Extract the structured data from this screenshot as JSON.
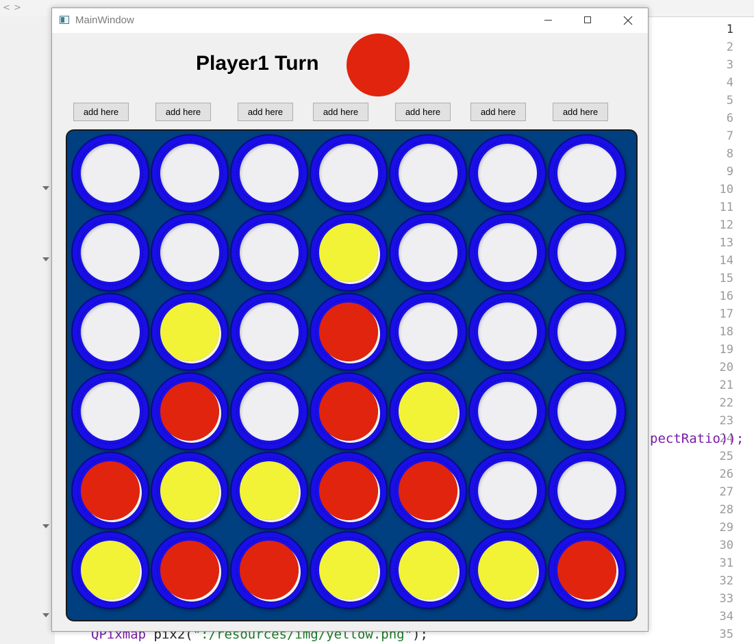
{
  "ide": {
    "nav_back": "<",
    "nav_forward": ">",
    "line_numbers": [
      "1",
      "2",
      "3",
      "4",
      "5",
      "6",
      "7",
      "8",
      "9",
      "10",
      "11",
      "12",
      "13",
      "14",
      "15",
      "16",
      "17",
      "18",
      "19",
      "20",
      "21",
      "22",
      "23",
      "24",
      "25",
      "26",
      "27",
      "28",
      "29",
      "30",
      "31",
      "32",
      "33",
      "34",
      "35"
    ],
    "code_fragment_line24": "pectRatio));",
    "code_line35_type": "QPixmap",
    "code_line35_rest": " pix2(",
    "code_line35_string": "\":/resources/img/yellow.png\"",
    "code_line35_end": ");"
  },
  "window": {
    "title": "MainWindow",
    "minimize_icon": "minimize-icon",
    "maximize_icon": "maximize-icon",
    "close_icon": "close-icon"
  },
  "game": {
    "turn_label": "Player1 Turn",
    "turn_color": "red",
    "add_button_label": "add here",
    "columns": 7,
    "rows": 6,
    "board": [
      [
        "empty",
        "empty",
        "empty",
        "empty",
        "empty",
        "empty",
        "empty"
      ],
      [
        "empty",
        "empty",
        "empty",
        "yellow",
        "empty",
        "empty",
        "empty"
      ],
      [
        "empty",
        "yellow",
        "empty",
        "red",
        "empty",
        "empty",
        "empty"
      ],
      [
        "empty",
        "red",
        "empty",
        "red",
        "yellow",
        "empty",
        "empty"
      ],
      [
        "red",
        "yellow",
        "yellow",
        "red",
        "red",
        "empty",
        "empty"
      ],
      [
        "yellow",
        "red",
        "red",
        "yellow",
        "yellow",
        "yellow",
        "red"
      ]
    ]
  },
  "colors": {
    "board_blue": "#003f80",
    "ring_blue": "#1a0ee8",
    "red": "#e0240e",
    "yellow": "#f2f236",
    "empty": "#efeff1"
  }
}
